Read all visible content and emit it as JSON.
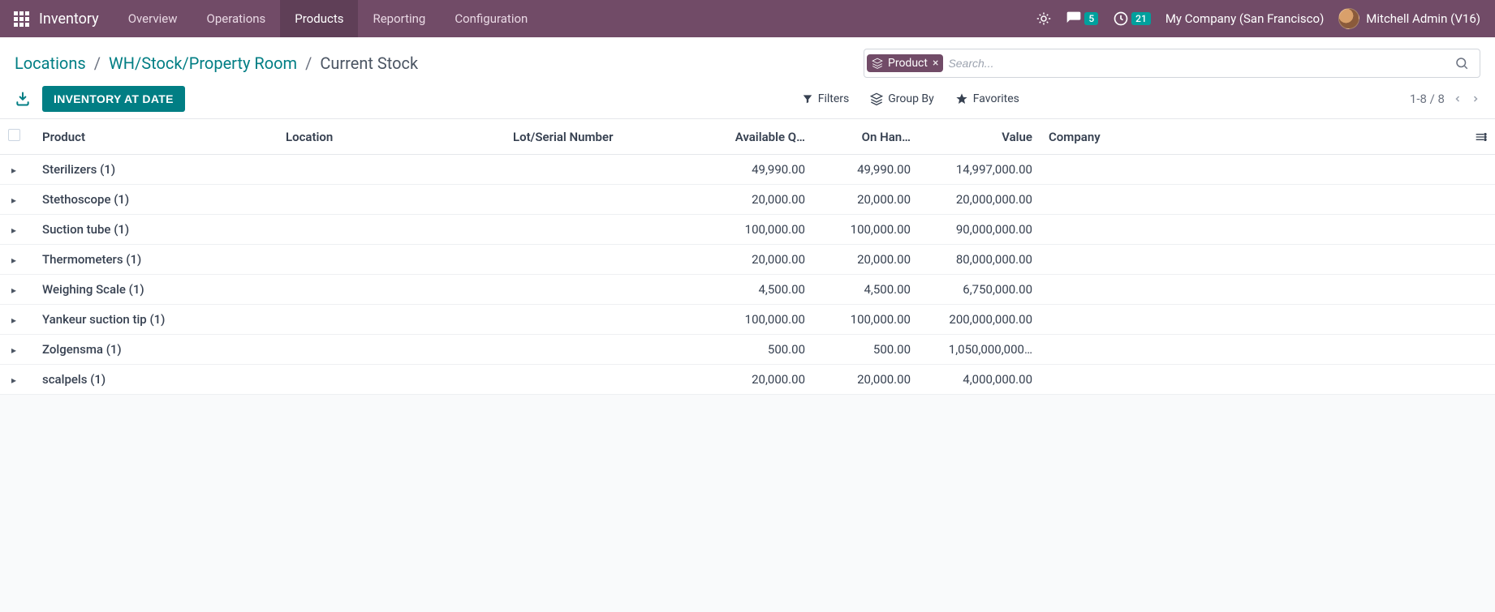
{
  "nav": {
    "app_title": "Inventory",
    "items": [
      {
        "label": "Overview",
        "active": false
      },
      {
        "label": "Operations",
        "active": false
      },
      {
        "label": "Products",
        "active": true
      },
      {
        "label": "Reporting",
        "active": false
      },
      {
        "label": "Configuration",
        "active": false
      }
    ],
    "messages_count": "5",
    "activities_count": "21",
    "company": "My Company (San Francisco)",
    "user": "Mitchell Admin (V16)"
  },
  "breadcrumb": {
    "parts": [
      {
        "label": "Locations",
        "link": true
      },
      {
        "label": "WH/Stock/Property Room",
        "link": true
      },
      {
        "label": "Current Stock",
        "link": false
      }
    ],
    "sep": "/"
  },
  "search": {
    "chip_label": "Product",
    "placeholder": "Search...",
    "value": ""
  },
  "actions": {
    "inventory_at_date": "INVENTORY AT DATE",
    "filters": "Filters",
    "group_by": "Group By",
    "favorites": "Favorites"
  },
  "pager": {
    "text": "1-8 / 8"
  },
  "table": {
    "headers": {
      "product": "Product",
      "location": "Location",
      "lot": "Lot/Serial Number",
      "available": "Available Q…",
      "on_hand": "On Han…",
      "value": "Value",
      "company": "Company"
    },
    "rows": [
      {
        "product": "Sterilizers (1)",
        "available": "49,990.00",
        "on_hand": "49,990.00",
        "value": "14,997,000.00"
      },
      {
        "product": "Stethoscope (1)",
        "available": "20,000.00",
        "on_hand": "20,000.00",
        "value": "20,000,000.00"
      },
      {
        "product": "Suction tube (1)",
        "available": "100,000.00",
        "on_hand": "100,000.00",
        "value": "90,000,000.00"
      },
      {
        "product": "Thermometers (1)",
        "available": "20,000.00",
        "on_hand": "20,000.00",
        "value": "80,000,000.00"
      },
      {
        "product": "Weighing Scale (1)",
        "available": "4,500.00",
        "on_hand": "4,500.00",
        "value": "6,750,000.00"
      },
      {
        "product": "Yankeur suction tip (1)",
        "available": "100,000.00",
        "on_hand": "100,000.00",
        "value": "200,000,000.00"
      },
      {
        "product": "Zolgensma (1)",
        "available": "500.00",
        "on_hand": "500.00",
        "value": "1,050,000,000…"
      },
      {
        "product": "scalpels (1)",
        "available": "20,000.00",
        "on_hand": "20,000.00",
        "value": "4,000,000.00"
      }
    ]
  }
}
